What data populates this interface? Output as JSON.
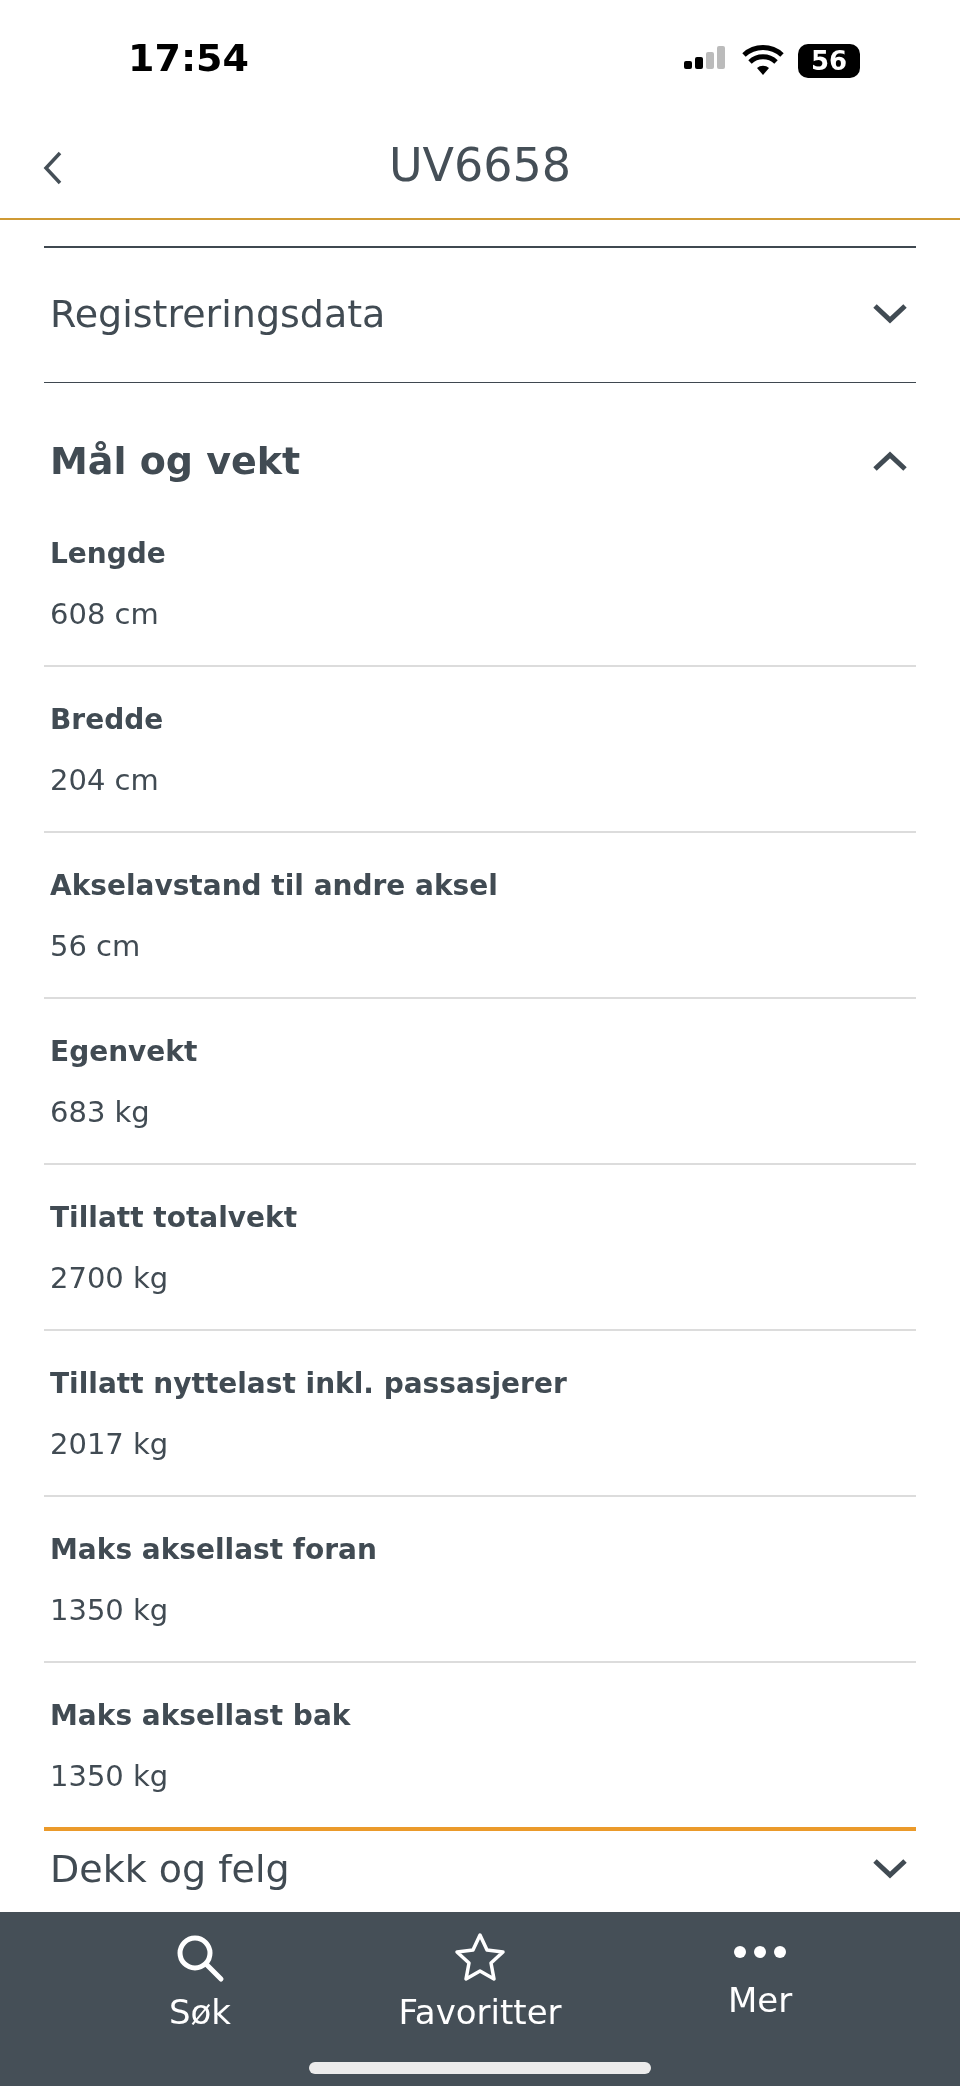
{
  "status_bar": {
    "time": "17:54",
    "battery": "56"
  },
  "header": {
    "title": "UV6658"
  },
  "sections": [
    {
      "title": "Registreringsdata",
      "expanded": false
    },
    {
      "title": "Mål og vekt",
      "expanded": true,
      "fields": [
        {
          "label": "Lengde",
          "value": "608 cm"
        },
        {
          "label": "Bredde",
          "value": "204 cm"
        },
        {
          "label": "Akselavstand til andre aksel",
          "value": "56 cm"
        },
        {
          "label": "Egenvekt",
          "value": "683 kg"
        },
        {
          "label": "Tillatt totalvekt",
          "value": "2700 kg"
        },
        {
          "label": "Tillatt nyttelast inkl. passasjerer",
          "value": "2017 kg"
        },
        {
          "label": "Maks aksellast foran",
          "value": "1350 kg"
        },
        {
          "label": "Maks aksellast bak",
          "value": "1350 kg"
        }
      ]
    },
    {
      "title": "Dekk og felg",
      "expanded": false
    }
  ],
  "tab_bar": [
    {
      "label": "Søk"
    },
    {
      "label": "Favoritter"
    },
    {
      "label": "Mer"
    }
  ]
}
